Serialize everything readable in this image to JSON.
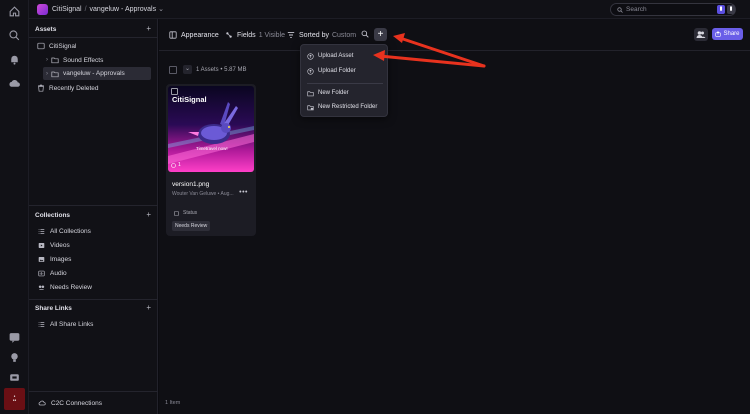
{
  "topbar": {
    "workspace": "CitiSignal",
    "separator": "/",
    "project": "vangeluw - Approvals",
    "search_placeholder": "Search"
  },
  "sidebar": {
    "assets_heading": "Assets",
    "tree": [
      {
        "label": "CitiSignal"
      },
      {
        "label": "Sound Effects"
      },
      {
        "label": "vangeluw - Approvals"
      },
      {
        "label": "Recently Deleted"
      }
    ],
    "collections_heading": "Collections",
    "collections": [
      {
        "label": "All Collections"
      },
      {
        "label": "Videos"
      },
      {
        "label": "Images"
      },
      {
        "label": "Audio"
      },
      {
        "label": "Needs Review"
      }
    ],
    "share_links_heading": "Share Links",
    "share_links": [
      {
        "label": "All Share Links"
      }
    ],
    "c2c_label": "C2C Connections"
  },
  "toolbar": {
    "appearance": "Appearance",
    "fields": "Fields",
    "fields_visible": "1 Visible",
    "sorted_by": "Sorted by",
    "sorted_value": "Custom",
    "share": "Share"
  },
  "selection": {
    "summary": "1 Assets • 5.87 MB"
  },
  "asset_card": {
    "brand": "CitiSignal",
    "tagline": "Timetravel now!",
    "comment_count": "1",
    "filename": "version1.png",
    "owner": "Wouter Van Geluwe • Aug...",
    "more": "•••",
    "status_label": "Status",
    "status_value": "Needs Review"
  },
  "footer": {
    "count": "1 Item"
  },
  "menu": {
    "items": [
      {
        "label": "Upload Asset"
      },
      {
        "label": "Upload Folder"
      },
      {
        "label": "New Folder"
      },
      {
        "label": "New Restricted Folder"
      }
    ]
  },
  "colors": {
    "accent": "#6a5ee8",
    "arrow": "#e8321e",
    "card": "#1c1c24"
  }
}
